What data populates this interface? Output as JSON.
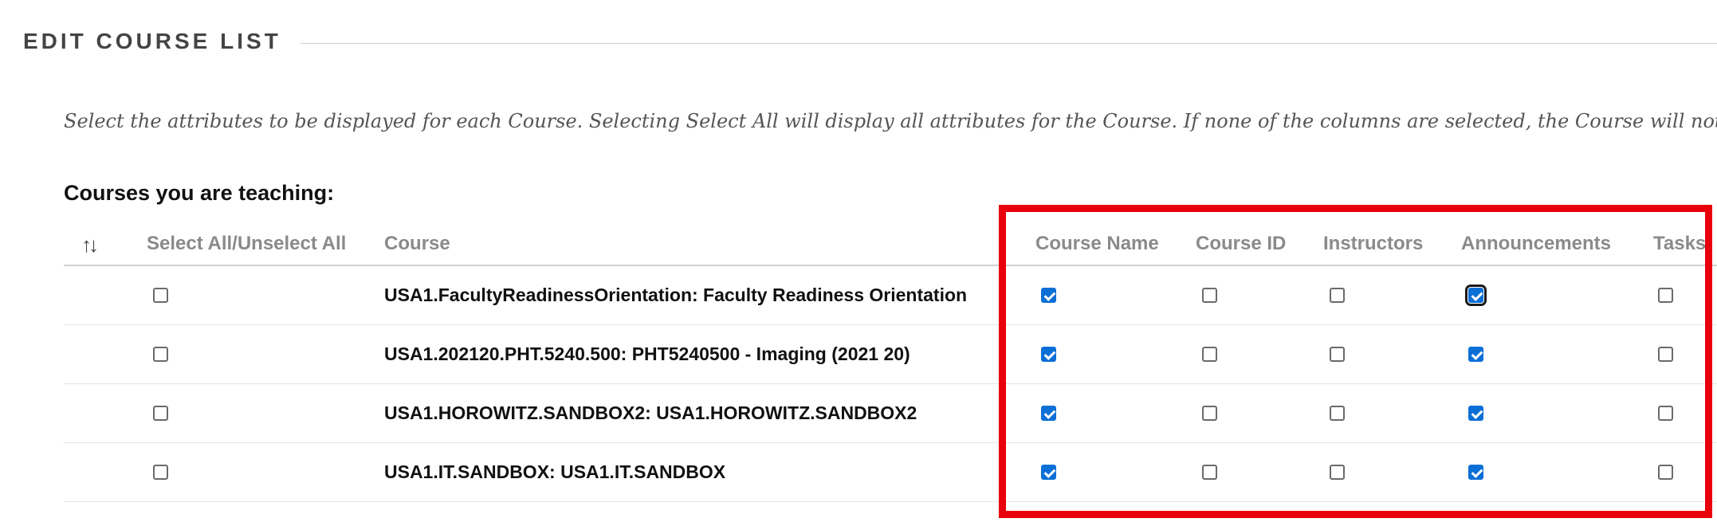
{
  "section": {
    "title": "EDIT COURSE LIST"
  },
  "description": "Select the attributes to be displayed for each Course. Selecting Select All will display all attributes for the Course. If none of the columns are selected, the Course will not appear in the m",
  "subheading": "Courses you are teaching:",
  "table": {
    "sort_icon": "sort-icon",
    "headers": {
      "select_all": "Select All/Unselect All",
      "course": "Course",
      "course_name": "Course Name",
      "course_id": "Course ID",
      "instructors": "Instructors",
      "announcements": "Announcements",
      "tasks": "Tasks"
    },
    "rows": [
      {
        "course": "USA1.FacultyReadinessOrientation: Faculty Readiness Orientation",
        "select_all": false,
        "course_name": true,
        "course_id": false,
        "instructors": false,
        "announcements": true,
        "tasks": false
      },
      {
        "course": "USA1.202120.PHT.5240.500: PHT5240500 - Imaging (2021 20)",
        "select_all": false,
        "course_name": true,
        "course_id": false,
        "instructors": false,
        "announcements": true,
        "tasks": false
      },
      {
        "course": "USA1.HOROWITZ.SANDBOX2: USA1.HOROWITZ.SANDBOX2",
        "select_all": false,
        "course_name": true,
        "course_id": false,
        "instructors": false,
        "announcements": true,
        "tasks": false
      },
      {
        "course": "USA1.IT.SANDBOX: USA1.IT.SANDBOX",
        "select_all": false,
        "course_name": true,
        "course_id": false,
        "instructors": false,
        "announcements": true,
        "tasks": false
      }
    ]
  },
  "colors": {
    "accent": "#0b6fd6",
    "highlight": "#e8000b"
  }
}
